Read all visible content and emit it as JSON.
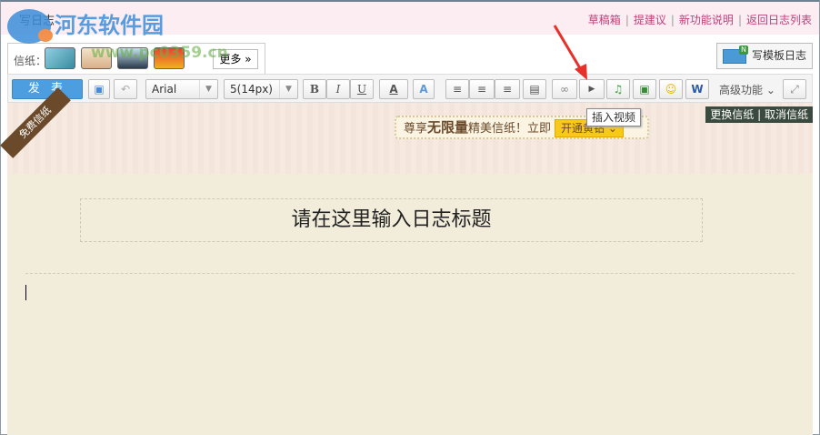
{
  "header": {
    "title": "写日志",
    "links": [
      "草稿箱",
      "提建议",
      "新功能说明",
      "返回日志列表"
    ]
  },
  "watermark": {
    "text": "河东软件园",
    "url": "www.pc0359.cn"
  },
  "paper_bar": {
    "label": "信纸：",
    "more": "更多 »"
  },
  "template_button": {
    "label": "写模板日志",
    "badge": "N"
  },
  "toolbar": {
    "publish": "发 表",
    "font": "Arial",
    "size": "5(14px)",
    "bold": "B",
    "italic": "I",
    "underline": "U",
    "color": "A",
    "advanced": "高级功能 ⌄"
  },
  "tooltip": "插入视频",
  "promo": {
    "prefix": "尊享",
    "bold": "无限量",
    "suffix": "精美信纸！立即",
    "vip": "开通黄钻 ⌄"
  },
  "ribbon": "免费信纸",
  "paper_actions": {
    "change": "更换信纸",
    "sep": "|",
    "cancel": "取消信纸"
  },
  "editor": {
    "title_placeholder": "请在这里输入日志标题"
  }
}
